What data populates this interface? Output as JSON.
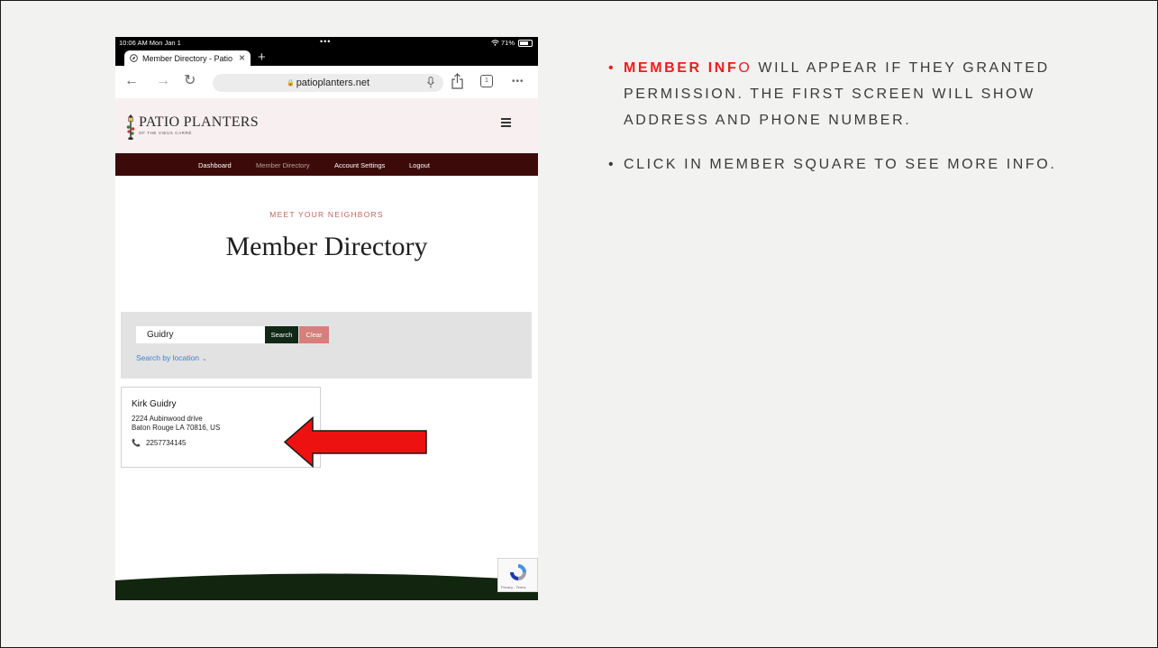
{
  "device": {
    "status_bar": {
      "time": "10:06 AM  Mon Jan 1",
      "dots": "•••",
      "battery": "71%",
      "battery_level": 0.71
    },
    "tab": {
      "title": "Member Directory - Patio Planters",
      "close": "×",
      "add": "+"
    },
    "toolbar": {
      "back": "←",
      "forward": "→",
      "reload": "↻",
      "url": "patioplanters.net",
      "lock": "🔒",
      "tabs_count": "1",
      "more": "•••"
    },
    "site": {
      "logo_main": "PATIO PLANTERS",
      "logo_sub": "OF THE VIEUX CARRÉ",
      "nav": [
        {
          "label": "Dashboard"
        },
        {
          "label": "Member Directory"
        },
        {
          "label": "Account Settings"
        },
        {
          "label": "Logout"
        }
      ],
      "kicker": "MEET YOUR NEIGHBORS",
      "heading": "Member Directory",
      "search": {
        "value": "Guidry",
        "search_label": "Search",
        "clear_label": "Clear",
        "location_link": "Search by location",
        "location_chevron": "⌄"
      },
      "member": {
        "name": "Kirk Guidry",
        "address_line1": "2224 Aubinwood drive",
        "address_line2": "Baton Rouge LA 70816, US",
        "phone_icon": "📞",
        "phone": "2257734145"
      },
      "recaptcha_text": "Privacy - Terms"
    }
  },
  "bullets": [
    {
      "dot": "•",
      "highlight_bold": "MEMBER INF",
      "highlight_plain": "O",
      "rest": " WILL APPEAR IF THEY GRANTED PERMISSION. THE FIRST SCREEN WILL SHOW ADDRESS AND PHONE NUMBER."
    },
    {
      "dot": "•",
      "text": "CLICK IN MEMBER SQUARE TO SEE MORE INFO."
    }
  ],
  "colors": {
    "highlight": "#ee1c1c",
    "nav_bg": "#3d0a0a",
    "search_btn": "#102815",
    "clear_btn": "#d67f7c",
    "footer_green": "#12250f",
    "arrow_fill": "#ee1111"
  }
}
